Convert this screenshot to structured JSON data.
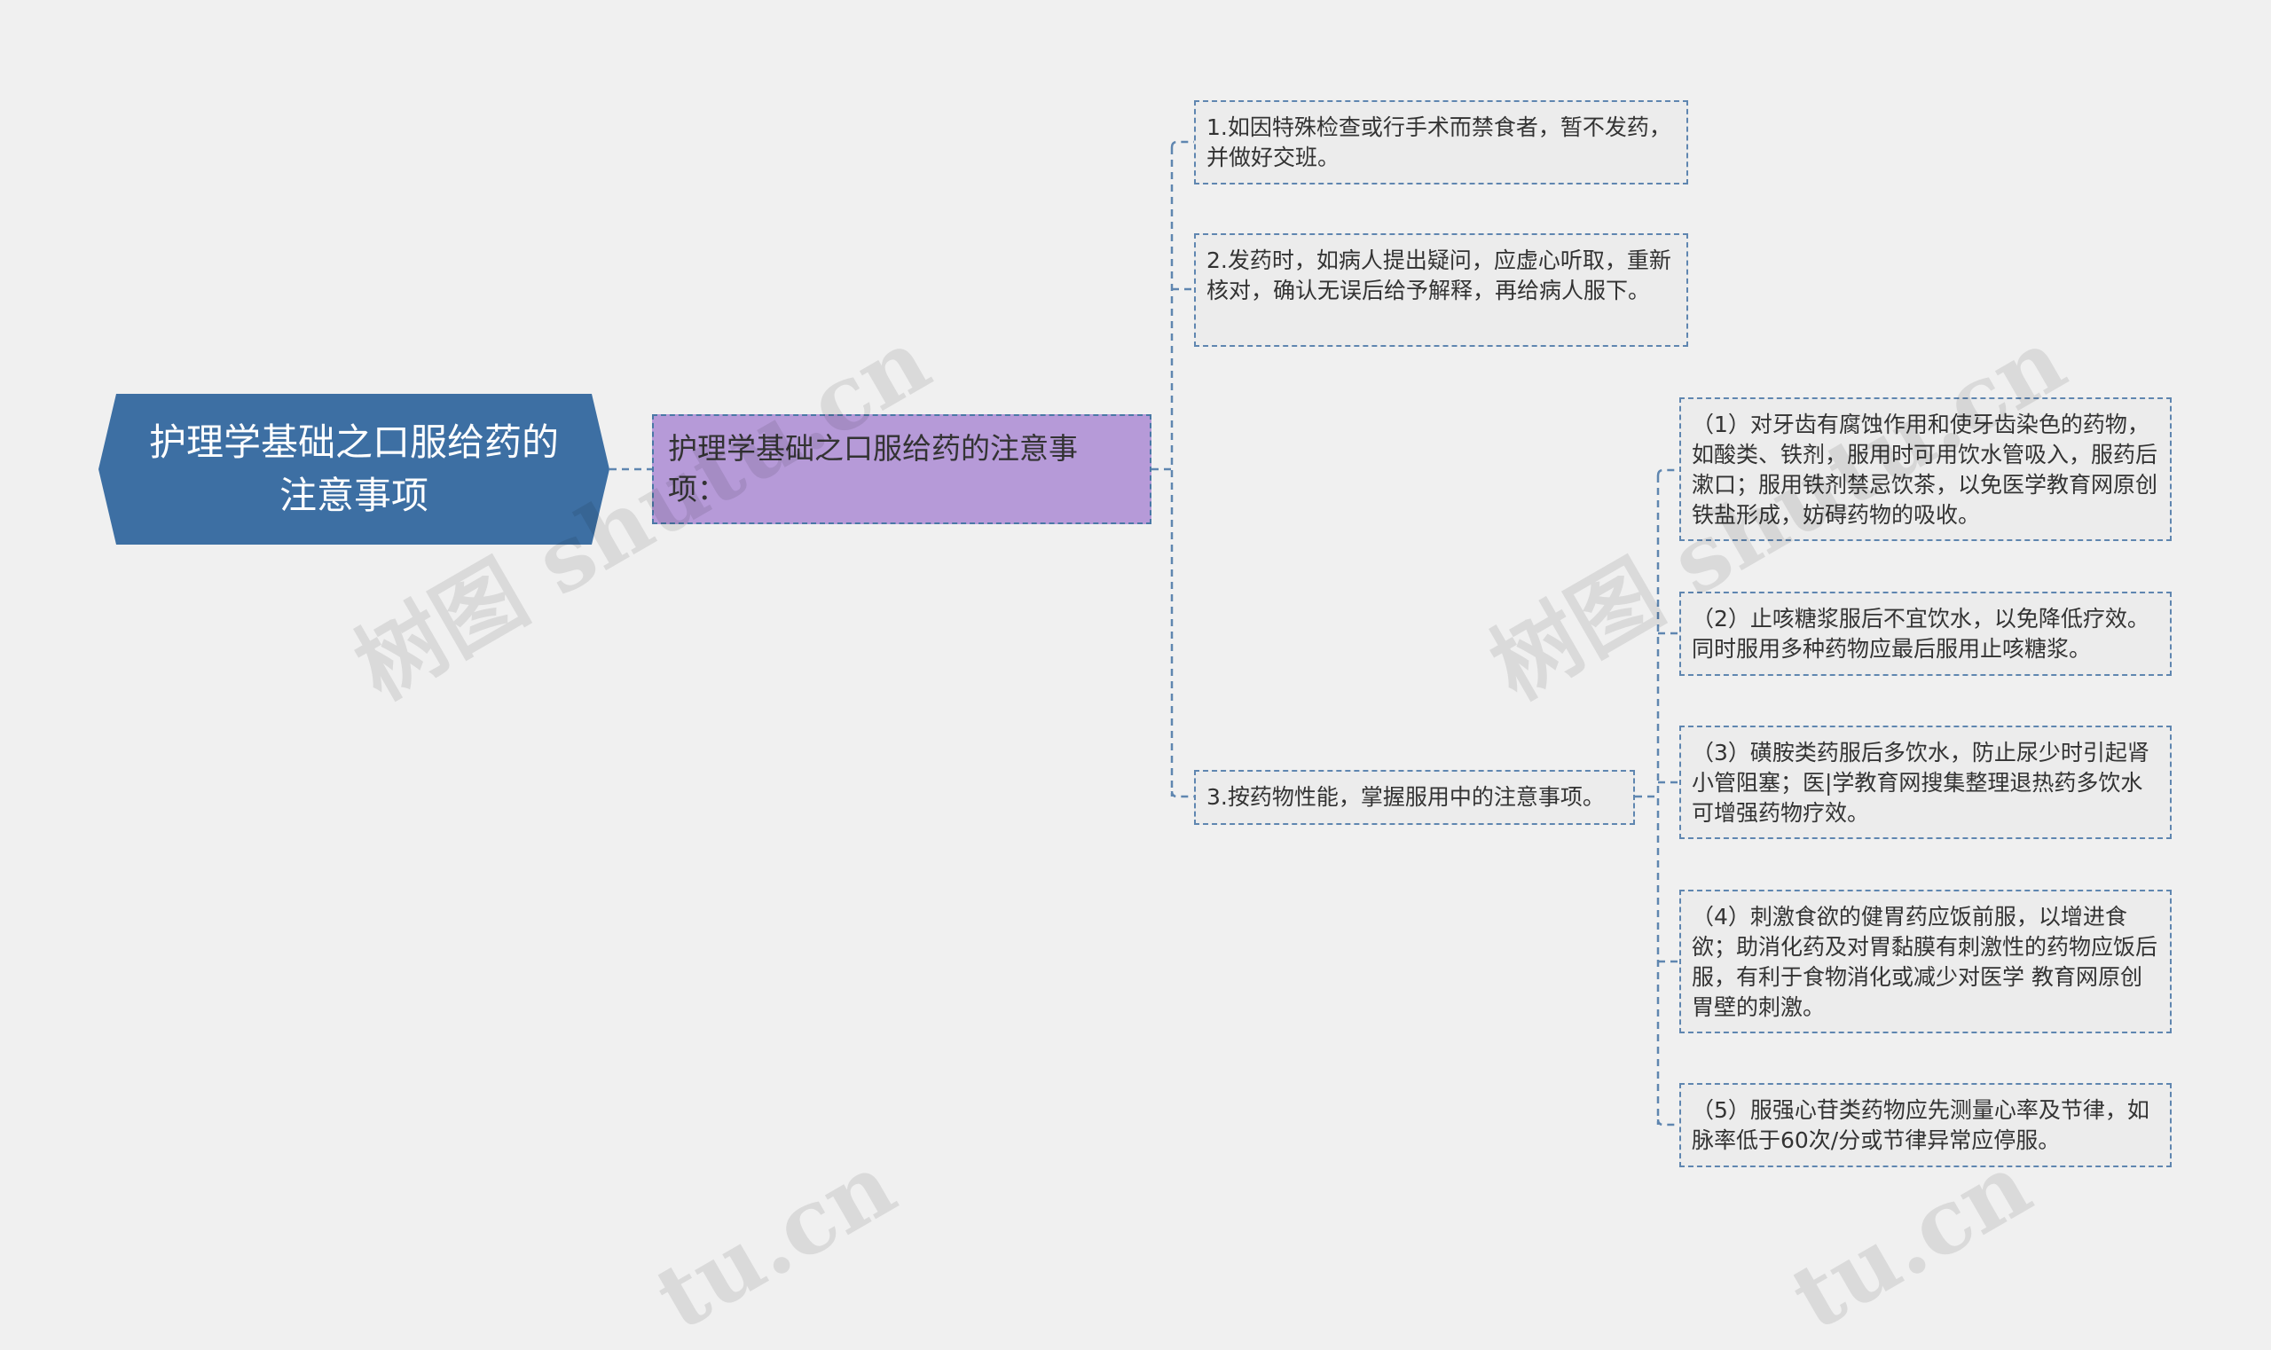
{
  "root": {
    "title": "护理学基础之口服给药的注意事项"
  },
  "sub": {
    "text": "护理学基础之口服给药的注意事项："
  },
  "items": [
    {
      "text": "1.如因特殊检查或行手术而禁食者，暂不发药，并做好交班。"
    },
    {
      "text": "2.发药时，如病人提出疑问，应虚心听取，重新核对，确认无误后给予解释，再给病人服下。"
    },
    {
      "text": "3.按药物性能，掌握服用中的注意事项。"
    }
  ],
  "details": [
    {
      "text": "（1）对牙齿有腐蚀作用和使牙齿染色的药物，如酸类、铁剂，服用时可用饮水管吸入，服药后漱口；服用铁剂禁忌饮茶，以免医学教育网原创铁盐形成，妨碍药物的吸收。"
    },
    {
      "text": "（2）止咳糖浆服后不宜饮水，以免降低疗效。同时服用多种药物应最后服用止咳糖浆。"
    },
    {
      "text": "（3）磺胺类药服后多饮水，防止尿少时引起肾小管阻塞；医|学教育网搜集整理退热药多饮水可增强药物疗效。"
    },
    {
      "text": "（4）刺激食欲的健胃药应饭前服，以增进食欲；助消化药及对胃黏膜有刺激性的药物应饭后服，有利于食物消化或减少对医学 教育网原创胃壁的刺激。"
    },
    {
      "text": "（5）服强心苷类药物应先测量心率及节律，如脉率低于60次/分或节律异常应停服。"
    }
  ],
  "watermark": {
    "text": "树图 shutu.cn",
    "partial": "tu.cn"
  },
  "colors": {
    "root_fill": "#3d6fa3",
    "sub_fill": "#b69ad8",
    "leaf_fill": "#ececec",
    "border": "#5f86b0",
    "background": "#f0f0f0"
  }
}
